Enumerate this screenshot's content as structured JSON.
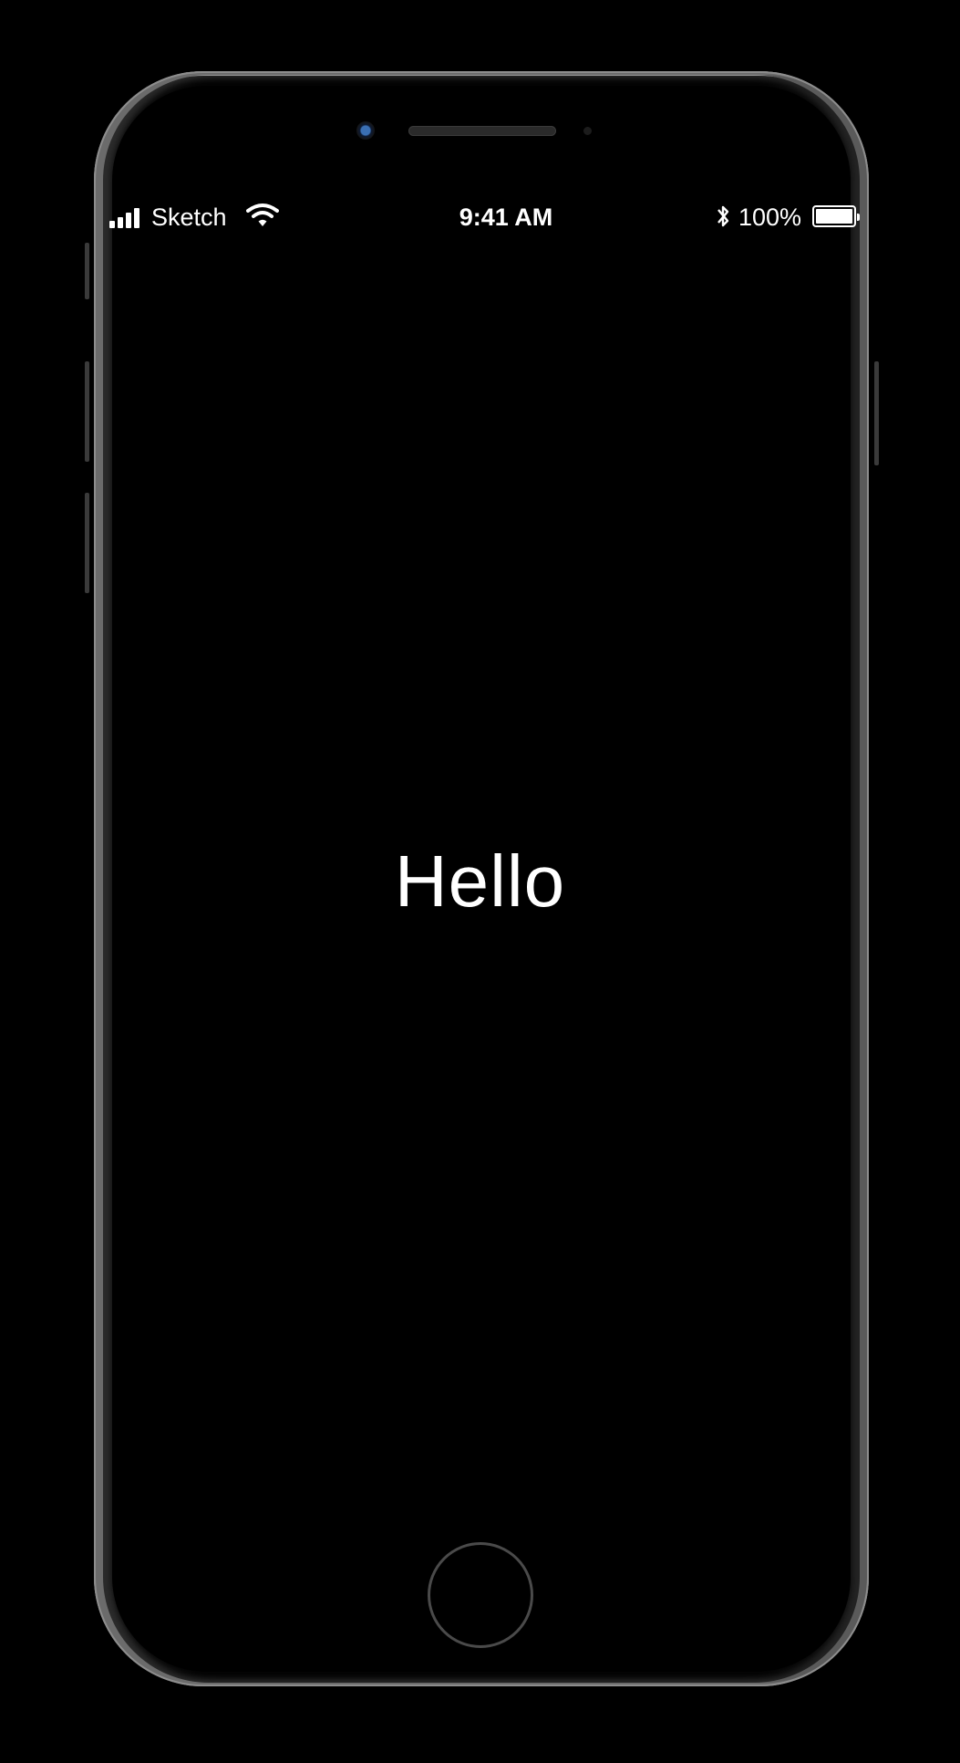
{
  "status_bar": {
    "carrier": "Sketch",
    "time": "9:41 AM",
    "battery_percent": "100%",
    "battery_level": 1.0,
    "icons": [
      "signal-icon",
      "wifi-icon",
      "bluetooth-icon",
      "battery-icon"
    ]
  },
  "screen": {
    "greeting": "Hello"
  },
  "colors": {
    "background": "#000000",
    "text": "#ffffff"
  }
}
